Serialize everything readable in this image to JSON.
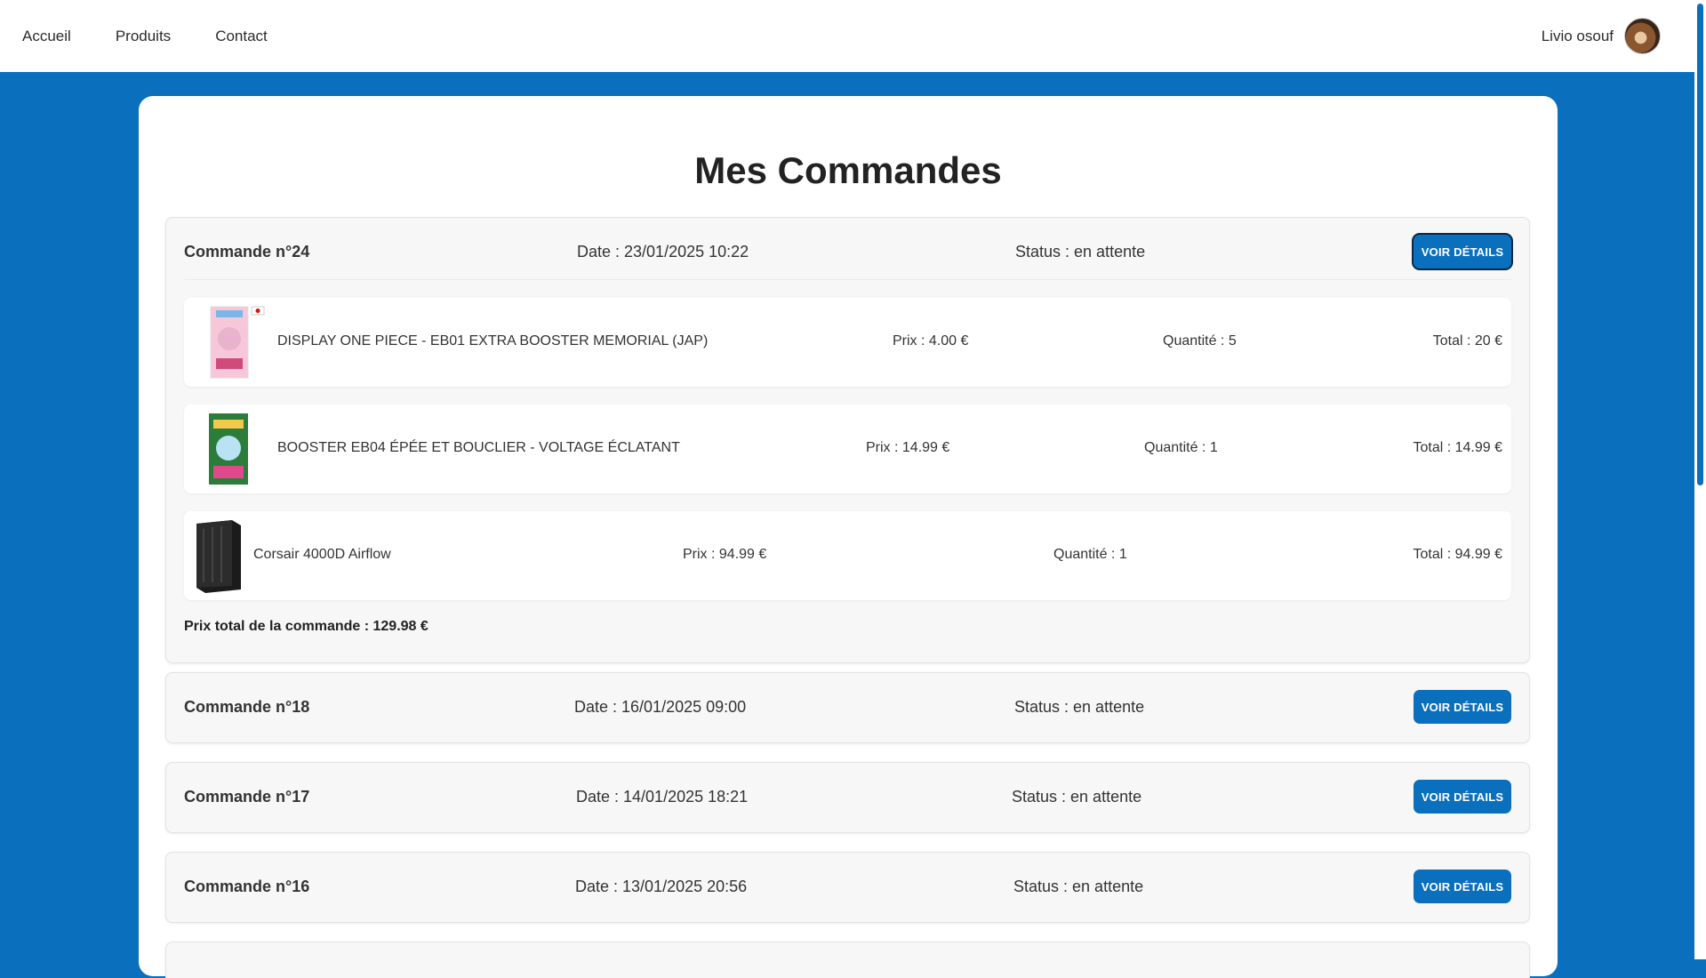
{
  "nav": {
    "links": [
      "Accueil",
      "Produits",
      "Contact"
    ],
    "user_name": "Livio osouf"
  },
  "page": {
    "title": "Mes Commandes"
  },
  "orders": [
    {
      "number": "Commande n°24",
      "date": "Date : 23/01/2025 10:22",
      "status": "Status : en attente",
      "button": "VOIR DÉTAILS",
      "items": [
        {
          "name": "DISPLAY ONE PIECE - EB01 EXTRA BOOSTER MEMORIAL (JAP)",
          "price": "Prix : 4.00 €",
          "quantity": "Quantité : 5",
          "total": "Total : 20 €"
        },
        {
          "name": "BOOSTER EB04 ÉPÉE ET BOUCLIER - VOLTAGE ÉCLATANT",
          "price": "Prix : 14.99 €",
          "quantity": "Quantité : 1",
          "total": "Total : 14.99 €"
        },
        {
          "name": "Corsair 4000D Airflow",
          "price": "Prix : 94.99 €",
          "quantity": "Quantité : 1",
          "total": "Total : 94.99 €"
        }
      ],
      "order_total": "Prix total de la commande : 129.98 €"
    },
    {
      "number": "Commande n°18",
      "date": "Date : 16/01/2025 09:00",
      "status": "Status : en attente",
      "button": "VOIR DÉTAILS"
    },
    {
      "number": "Commande n°17",
      "date": "Date : 14/01/2025 18:21",
      "status": "Status : en attente",
      "button": "VOIR DÉTAILS"
    },
    {
      "number": "Commande n°16",
      "date": "Date : 13/01/2025 20:56",
      "status": "Status : en attente",
      "button": "VOIR DÉTAILS"
    }
  ],
  "colors": {
    "accent": "#0a6fbd",
    "card": "#ffffff",
    "order_bg": "#f7f7f7"
  }
}
